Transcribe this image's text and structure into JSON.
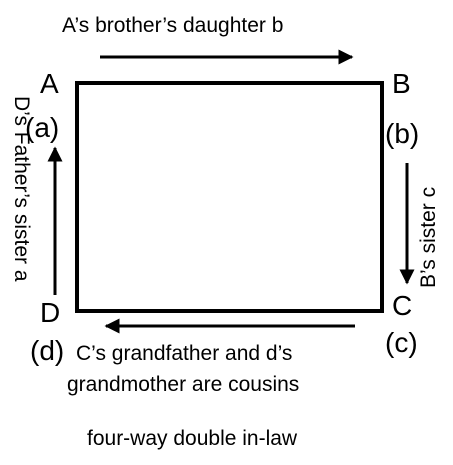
{
  "diagram": {
    "corners": {
      "A": {
        "letter": "A",
        "label": "(a)"
      },
      "B": {
        "letter": "B",
        "label": "(b)"
      },
      "C": {
        "letter": "C",
        "label": "(c)"
      },
      "D": {
        "letter": "D",
        "label": "(d)"
      }
    },
    "edges": {
      "top": "A’s brother’s daughter b",
      "right": "B’s sister c",
      "bottom_line1": "C’s grandfather and d’s",
      "bottom_line2": "grandmother are cousins",
      "left": "D’s Father’s sister a"
    },
    "caption": "four-way double in-law"
  }
}
